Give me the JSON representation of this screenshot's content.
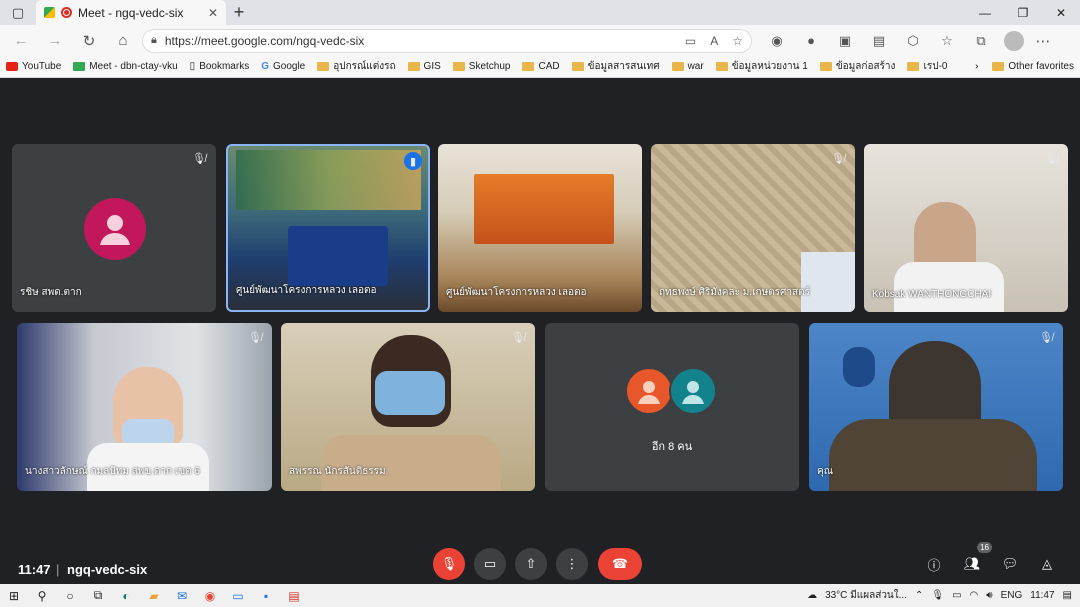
{
  "tab": {
    "title": "Meet - ngq-vedc-six"
  },
  "address": {
    "url": "https://meet.google.com/ngq-vedc-six"
  },
  "bookmarks": [
    "YouTube",
    "Meet - dbn-ctay-vku",
    "Bookmarks",
    "Google",
    "อุปกรณ์แต่งรถ",
    "GIS",
    "Sketchup",
    "CAD",
    "ข้อมูลสารสนเทศ",
    "war",
    "ข้อมูลหน่วยงาน 1",
    "ข้อมูลก่อสร้าง",
    "เรป-0"
  ],
  "bookmarks_other": "Other favorites",
  "participants": [
    {
      "name": "รชิษ สพด.ตาก"
    },
    {
      "name": "ศูนย์พัฒนาโครงการหลวง เลอตอ"
    },
    {
      "name": "ศูนย์พัฒนาโครงการหลวง เลอตอ"
    },
    {
      "name": "ฤทธพงษ์ ศิริมังคละ ม.เกษตรศาสตร์"
    },
    {
      "name": "Kobsak WANTHONGCHAI"
    },
    {
      "name": "นางสาวลักษณ์ กมลปัทม สพข.ตาก เขต 6"
    },
    {
      "name": "สพรรณ นักรสันติธรรม"
    },
    {
      "name": "อีก 8 คน"
    },
    {
      "name": "คุณ"
    }
  ],
  "meeting": {
    "time": "11:47",
    "code": "ngq-vedc-six",
    "people_count": "16"
  },
  "taskbar": {
    "weather": "33°C มีแผลส่วนใ...",
    "lang": "ENG",
    "time": "11:47"
  }
}
